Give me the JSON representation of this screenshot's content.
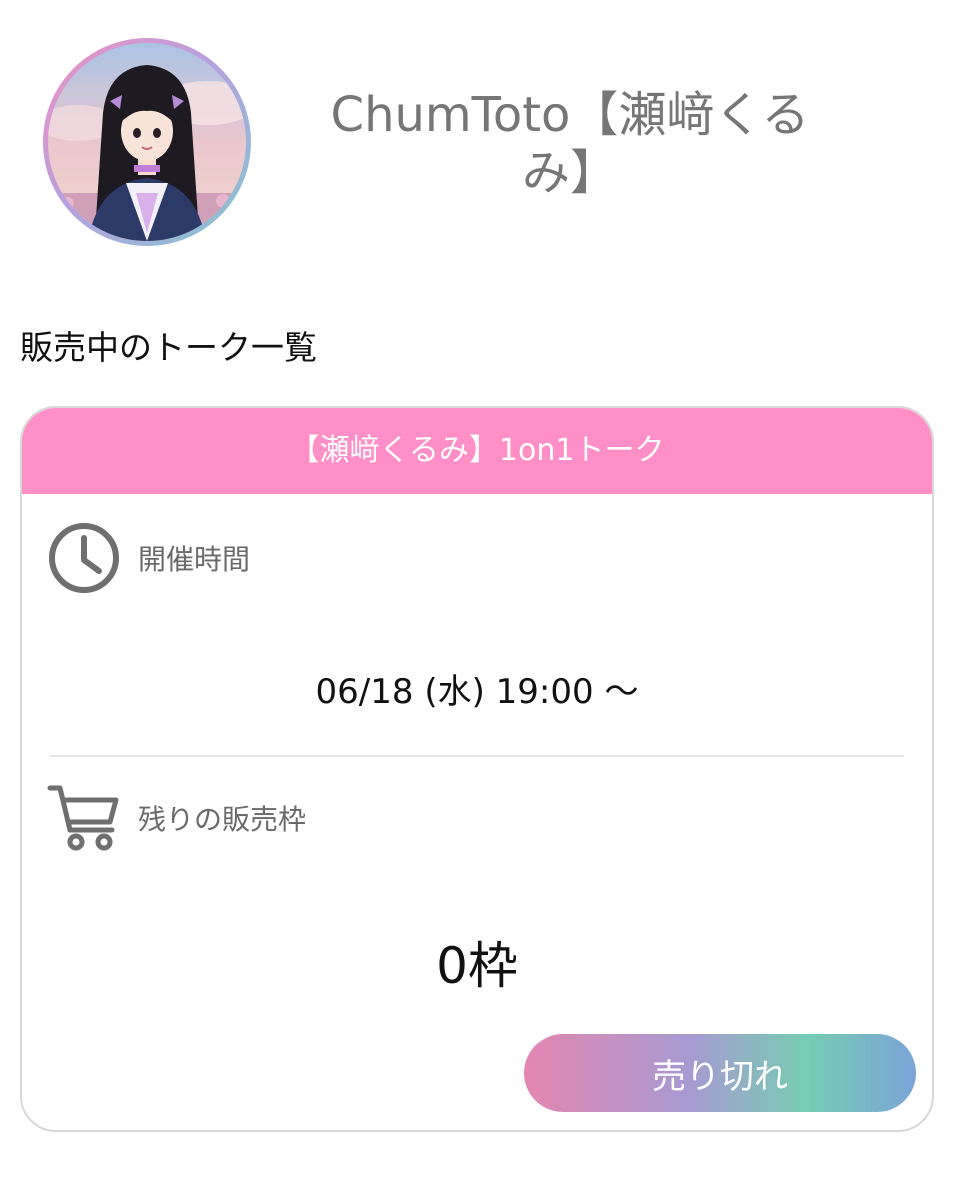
{
  "profile": {
    "name": "ChumToto【瀬﨑くるみ】"
  },
  "section": {
    "title": "販売中のトーク一覧"
  },
  "talk_card": {
    "title": "【瀬﨑くるみ】1on1トーク",
    "event_time_label": "開催時間",
    "event_time_value": "06/18 (水) 19:00 〜",
    "remaining_label": "残りの販売枠",
    "remaining_value": "0枠",
    "status_button": "売り切れ",
    "icons": [
      "clock-icon",
      "cart-icon"
    ]
  },
  "colors": {
    "header_pink": "#ff8fc6",
    "button_gradient": [
      "#e486b0",
      "#a89ad2",
      "#76cdb3",
      "#7aa4d8"
    ],
    "name_gray": "#767676"
  }
}
